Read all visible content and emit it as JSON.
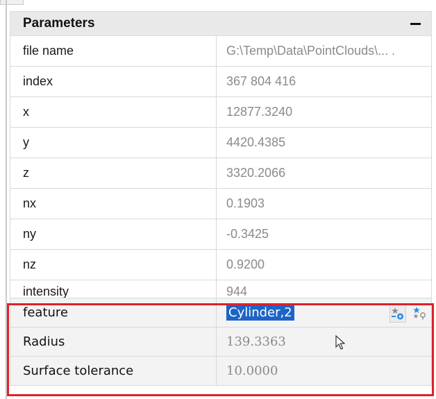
{
  "panel": {
    "title": "Parameters",
    "collapse_label": "−"
  },
  "rows": [
    {
      "label": "file name",
      "value": "G:\\Temp\\Data\\PointClouds\\... ."
    },
    {
      "label": "index",
      "value": "367 804 416"
    },
    {
      "label": "x",
      "value": "12877.3240"
    },
    {
      "label": "y",
      "value": "4420.4385"
    },
    {
      "label": "z",
      "value": "3320.2066"
    },
    {
      "label": "nx",
      "value": "0.1903"
    },
    {
      "label": "ny",
      "value": "-0.3425"
    },
    {
      "label": "nz",
      "value": "0.9200"
    },
    {
      "label": "intensity",
      "value": "944"
    }
  ],
  "feature_group": {
    "feature": {
      "label": "feature",
      "value": "Cylinder,2"
    },
    "radius": {
      "label": "Radius",
      "value": "139.3363"
    },
    "surface_tolerance": {
      "label": "Surface tolerance",
      "value": "10.0000"
    }
  },
  "icons": {
    "feature_icon_1": "star-settings-icon",
    "feature_icon_2": "star-pin-icon",
    "collapse": "minus-icon"
  },
  "colors": {
    "highlight_border": "#e0202a",
    "selection_bg": "#1c64c8",
    "header_bg": "#e9e9e9",
    "value_text": "#8a8a8a"
  }
}
